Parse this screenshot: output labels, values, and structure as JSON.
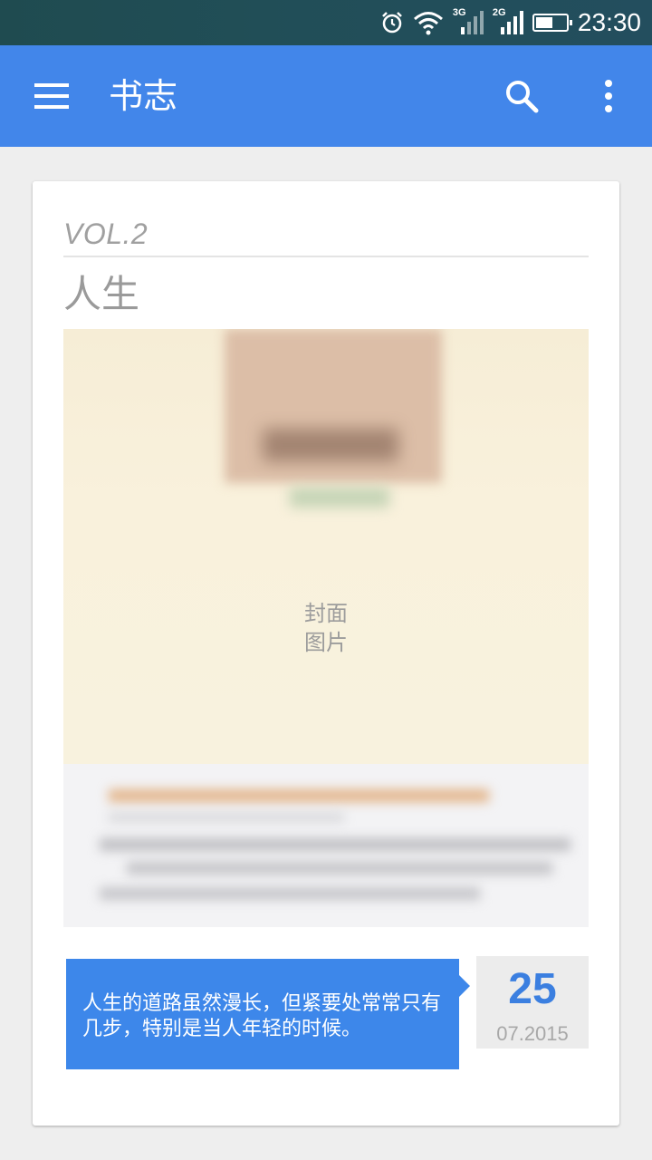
{
  "status_bar": {
    "time": "23:30",
    "network_1": "3G",
    "network_2": "2G",
    "icons": [
      "alarm-icon",
      "wifi-icon",
      "signal-3g-icon",
      "signal-2g-icon",
      "battery-icon"
    ],
    "battery_level": 0.55
  },
  "app_bar": {
    "title": "书志",
    "color": "#4286ea",
    "icons": [
      "menu-icon",
      "search-icon",
      "more-vert-icon"
    ]
  },
  "card": {
    "volume": "VOL.2",
    "title": "人生",
    "cover_label_line1": "封面",
    "cover_label_line2": "图片",
    "quote": "人生的道路虽然漫长，但紧要处常常只有几步，特别是当人年轻的时候。",
    "date_day": "25",
    "date_month_year": "07.2015",
    "accent_color": "#3d87ea"
  }
}
